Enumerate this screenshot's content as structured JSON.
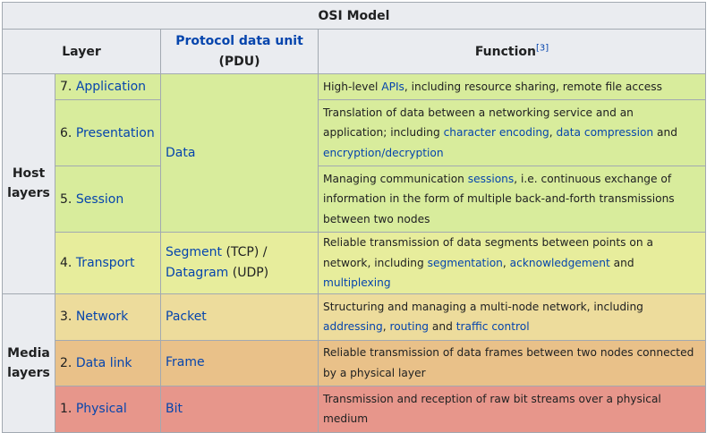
{
  "table": {
    "title": "OSI Model",
    "header": {
      "layer": "Layer",
      "pdu_link": "Protocol data unit",
      "pdu_abbr": "(PDU)",
      "function": "Function",
      "function_ref": "[3]"
    },
    "groups": {
      "host": "Host layers",
      "media": "Media layers"
    },
    "rows": [
      {
        "num": "7.",
        "layer": "Application",
        "function": [
          {
            "t": "High-level "
          },
          {
            "t": "APIs",
            "link": true
          },
          {
            "t": ", including resource sharing, remote file access"
          }
        ]
      },
      {
        "num": "6.",
        "layer": "Presentation",
        "function": [
          {
            "t": "Translation of data between a networking service and an application; including "
          },
          {
            "t": "character encoding",
            "link": true
          },
          {
            "t": ", "
          },
          {
            "t": "data compression",
            "link": true
          },
          {
            "t": " and "
          },
          {
            "t": "encryption/decryption",
            "link": true
          }
        ]
      },
      {
        "num": "5.",
        "layer": "Session",
        "function": [
          {
            "t": "Managing communication "
          },
          {
            "t": "sessions",
            "link": true
          },
          {
            "t": ", i.e. continuous exchange of information in the form of multiple back-and-forth transmissions between two nodes"
          }
        ]
      },
      {
        "num": "4.",
        "layer": "Transport",
        "function": [
          {
            "t": "Reliable transmission of data segments between points on a network, including "
          },
          {
            "t": "segmentation",
            "link": true
          },
          {
            "t": ", "
          },
          {
            "t": "acknowledgement",
            "link": true
          },
          {
            "t": " and "
          },
          {
            "t": "multiplexing",
            "link": true
          }
        ]
      },
      {
        "num": "3.",
        "layer": "Network",
        "function": [
          {
            "t": "Structuring and managing a multi-node network, including "
          },
          {
            "t": "addressing",
            "link": true
          },
          {
            "t": ", "
          },
          {
            "t": "routing",
            "link": true
          },
          {
            "t": " and "
          },
          {
            "t": "traffic control",
            "link": true
          }
        ]
      },
      {
        "num": "2.",
        "layer": "Data link",
        "function": [
          {
            "t": "Reliable transmission of data frames between two nodes connected by a physical layer"
          }
        ]
      },
      {
        "num": "1.",
        "layer": "Physical",
        "function": [
          {
            "t": "Transmission and reception of raw bit streams over a physical medium"
          }
        ]
      }
    ],
    "pdu": {
      "data": "Data",
      "segment": "Segment",
      "segment_suffix": " (TCP) /",
      "datagram": "Datagram",
      "datagram_suffix": " (UDP)",
      "packet": "Packet",
      "frame": "Frame",
      "bit": "Bit"
    },
    "colors": {
      "upper": "#d8ec9c",
      "transport": "#e7ed9c",
      "network": "#eddc9c",
      "datalink": "#e9c189",
      "physical": "#e7968b",
      "header": "#eaecf0",
      "link": "#0645ad"
    }
  }
}
